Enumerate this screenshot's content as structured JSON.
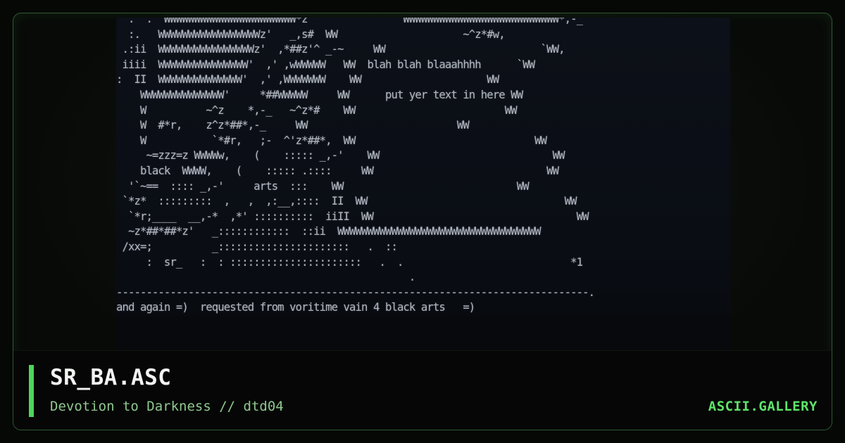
{
  "artwork": {
    "lines": [
      "  .  .  WWWWWWWWWWWWWWWWWWWWWW*z^^^             WWWWWWWWWWWWWWWWWWWWWWWWWW*,-_",
      "  :.   WWWWWWWWWWWWWWWWWz'   _,s#  WW                     ~^z*#w,",
      " .:ii  WWWWWWWWWWWWWWWWz'  ,*##z'^ _-~     WW                          `WW,",
      " iiii  WWWWWWWWWWWWWWW'  ,' ,wWWWWW   WW  blah blah blaaahhhh      `WW",
      ":  II  WWWWWWWWWWWWWW'  ,' ,WWWWWWW    WW                     WW",
      "    WWWWWWWWWWWWWW'     *##WWWWW     WW      put yer text in here WW",
      "    W          ~^z    *,-_   ~^z*#    WW                         WW",
      "    W  #*r,    z^z*##*,-_     WW                         WW",
      "    W           `*#r,   ;-  ^'z*##*,  WW                              WW",
      "     ~=zzz=z WWWWw,    (    ::::: _,-'    WW                             WW",
      "    black  WWWW,    (    ::::: .::::     WW                             WW",
      "  '`~==  :::: _,-'     arts  :::    WW                             WW",
      " `*z*  :::::::::  ,   ,  ,:__,::::  II  WW                                 WW",
      "  `*r;____  __,-*  ,*' ::::::::::  iiII  WW                                  WW",
      "  ~z*##*##*z'   _::::::::::::  ::ii  WWWWWWWWWWWWWWWWWWWWWWWWWWWWWWWWWW",
      " /xx=;          _::::::::::::::::::::::   .  ::",
      "     :  sr_   :  : ::::::::::::::::::::::   .  .                            *1",
      "                                                 .",
      "-------------------------------------------------------------------------------.",
      "and again =)  requested from voritime vain 4 black arts   =)"
    ]
  },
  "footer": {
    "title": "SR_BA.ASC",
    "subtitle": "Devotion to Darkness // dtd04",
    "brand": "ASCII.GALLERY"
  },
  "colors": {
    "accent": "#4fd65a",
    "brand": "#5fe36a",
    "subtitle": "#8fc88f",
    "art_text": "#c9cfd8",
    "art_background": "#0b0f16",
    "border": "#2e5a30"
  }
}
